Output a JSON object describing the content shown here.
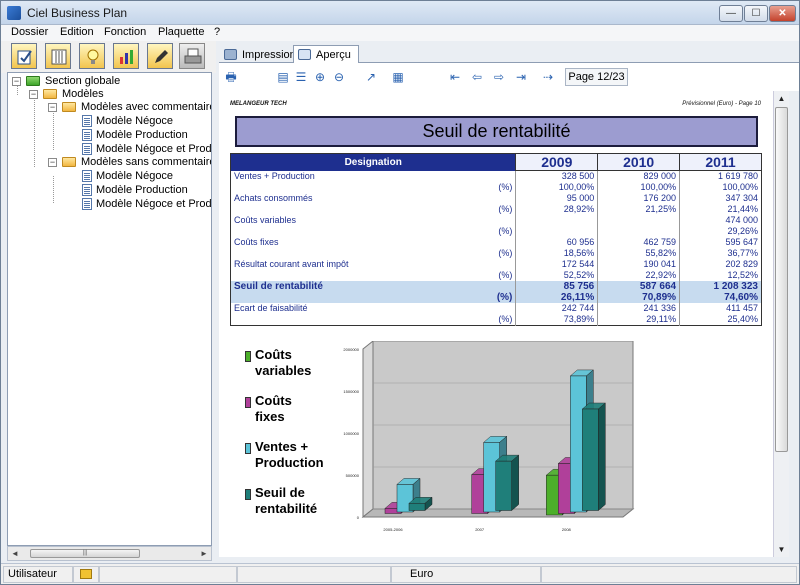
{
  "window": {
    "title": "Ciel Business Plan",
    "min": "—",
    "max": "☐",
    "close": "✕"
  },
  "menu": [
    "Dossier",
    "Edition",
    "Fonction",
    "Plaquette",
    "?"
  ],
  "tree": {
    "root": "Section globale",
    "models": "Modèles",
    "with_comments": "Modèles avec commentaires",
    "without_comments": "Modèles sans commentaires",
    "a1": "Modèle Négoce",
    "a2": "Modèle Production",
    "a3": "Modèle Négoce et Production",
    "b1": "Modèle Négoce",
    "b2": "Modèle Production",
    "b3": "Modèle Négoce et Production"
  },
  "tabs": {
    "impression": "Impression",
    "apercu": "Aperçu"
  },
  "page_indicator": "Page 12/23",
  "report": {
    "company": "MELANGEUR TECH",
    "header_right": "Prévisionnel (Euro) - Page 10",
    "title": "Seuil de rentabilité",
    "col_designation": "Designation",
    "years": [
      "2009",
      "2010",
      "2011"
    ],
    "rows": [
      {
        "label": "Ventes + Production",
        "values": [
          "328 500",
          "829 000",
          "1 619 780"
        ]
      },
      {
        "label": "(%)",
        "pct": true,
        "values": [
          "100,00%",
          "100,00%",
          "100,00%"
        ]
      },
      {
        "label": "Achats consommés",
        "values": [
          "95 000",
          "176 200",
          "347 304"
        ]
      },
      {
        "label": "(%)",
        "pct": true,
        "values": [
          "28,92%",
          "21,25%",
          "21,44%"
        ]
      },
      {
        "label": "Coûts variables",
        "values": [
          "",
          "",
          "474 000"
        ]
      },
      {
        "label": "(%)",
        "pct": true,
        "values": [
          "",
          "",
          "29,26%"
        ]
      },
      {
        "label": "Coûts fixes",
        "values": [
          "60 956",
          "462 759",
          "595 647"
        ]
      },
      {
        "label": "(%)",
        "pct": true,
        "values": [
          "18,56%",
          "55,82%",
          "36,77%"
        ]
      },
      {
        "label": "Résultat courant avant impôt",
        "values": [
          "172 544",
          "190 041",
          "202 829"
        ]
      },
      {
        "label": "(%)",
        "pct": true,
        "values": [
          "52,52%",
          "22,92%",
          "12,52%"
        ]
      },
      {
        "label": "Seuil de rentabilité",
        "hl": true,
        "values": [
          "85 756",
          "587 664",
          "1 208 323"
        ]
      },
      {
        "label": "(%)",
        "pct": true,
        "hl": true,
        "values": [
          "26,11%",
          "70,89%",
          "74,60%"
        ]
      },
      {
        "label": "Ecart de faisabilité",
        "values": [
          "242 744",
          "241 336",
          "411 457"
        ]
      },
      {
        "label": "(%)",
        "pct": true,
        "values": [
          "73,89%",
          "29,11%",
          "25,40%"
        ]
      }
    ]
  },
  "legend": [
    {
      "l1": "Coûts",
      "l2": "variables",
      "color": "#4caf2a"
    },
    {
      "l1": "Coûts",
      "l2": "fixes",
      "color": "#b0409a"
    },
    {
      "l1": "Ventes +",
      "l2": "Production",
      "color": "#5cc4d8"
    },
    {
      "l1": "Seuil de",
      "l2": "rentabilité",
      "color": "#1f7f7a"
    }
  ],
  "chart_data": {
    "type": "bar",
    "categories": [
      "2005-2006",
      "2007",
      "2008"
    ],
    "yticks": [
      "2000000",
      "1500000",
      "1000000",
      "500000",
      "0"
    ],
    "ylim": [
      0,
      2000000
    ],
    "series": [
      {
        "name": "Coûts variables",
        "color": "#4caf2a",
        "values": [
          0,
          0,
          474000
        ]
      },
      {
        "name": "Coûts fixes",
        "color": "#b0409a",
        "values": [
          60956,
          462759,
          595647
        ]
      },
      {
        "name": "Ventes + Production",
        "color": "#5cc4d8",
        "values": [
          328500,
          829000,
          1619780
        ]
      },
      {
        "name": "Seuil de rentabilité",
        "color": "#1f7f7a",
        "values": [
          85756,
          587664,
          1208323
        ]
      }
    ]
  },
  "status": {
    "user": "Utilisateur",
    "currency": "Euro"
  }
}
